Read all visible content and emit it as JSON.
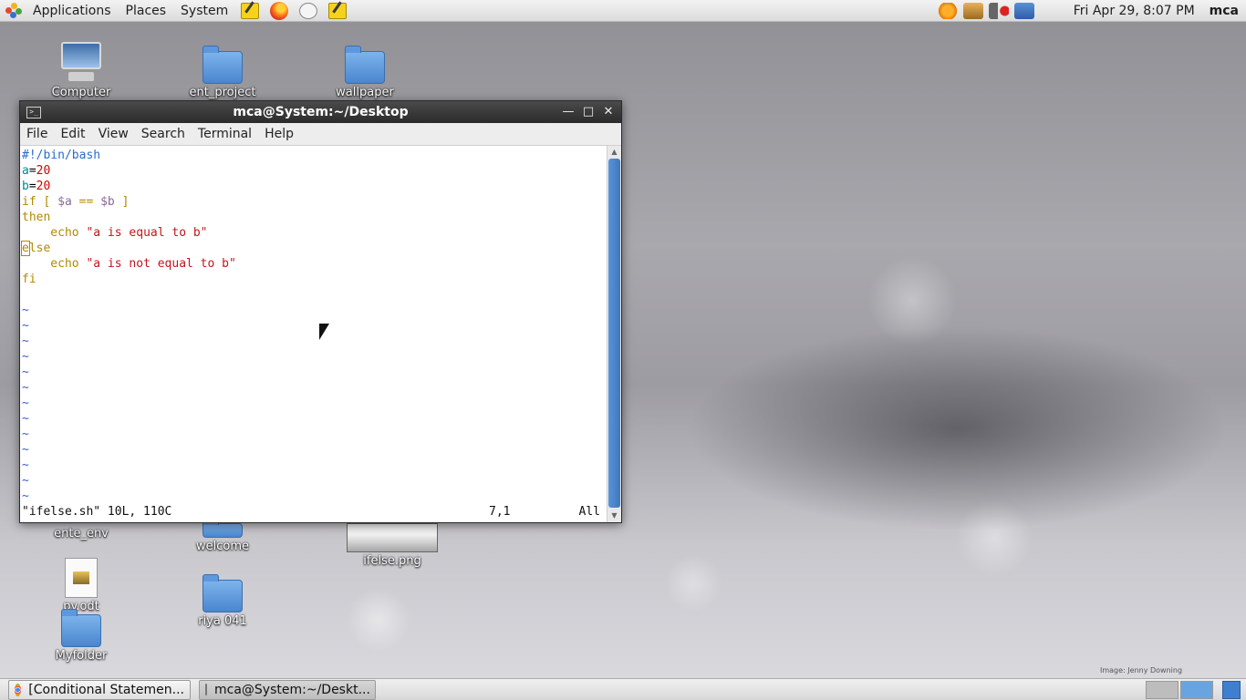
{
  "top_panel": {
    "menus": [
      "Applications",
      "Places",
      "System"
    ],
    "clock": "Fri Apr 29,  8:07 PM",
    "user": "mca"
  },
  "desktop": {
    "icons": {
      "computer": "Computer",
      "ent_project": "ent_project",
      "wallpaper": "wallpaper",
      "ente_env": "ente_env",
      "welcome": "welcome",
      "ifelse_png": "ifelse.png",
      "py_odt": "py.odt",
      "riya": "riya 041",
      "myfolder": "Myfolder"
    },
    "credit": "Image: Jenny Downing"
  },
  "terminal": {
    "title": "mca@System:~/Desktop",
    "menu": [
      "File",
      "Edit",
      "View",
      "Search",
      "Terminal",
      "Help"
    ],
    "code": {
      "shebang": "#!/bin/bash",
      "a_var": "a",
      "a_eq": "=",
      "a_val": "20",
      "b_var": "b",
      "b_eq": "=",
      "b_val": "20",
      "if_kw": "if [ ",
      "if_a": "$a",
      "if_op": " == ",
      "if_b": "$b",
      "if_end": " ]",
      "then_kw": "then",
      "echo1_cmd": "    echo ",
      "echo1_str": "\"a is equal to b\"",
      "else_first": "e",
      "else_rest": "lse",
      "echo2_cmd": "    echo ",
      "echo2_str": "\"a is not equal to b\"",
      "fi_kw": "fi",
      "tilde": "~"
    },
    "status": {
      "file_info": "\"ifelse.sh\" 10L, 110C",
      "position": "7,1",
      "percent": "All"
    }
  },
  "taskbar": {
    "tasks": [
      "[Conditional Statemen...",
      "mca@System:~/Deskt..."
    ]
  }
}
